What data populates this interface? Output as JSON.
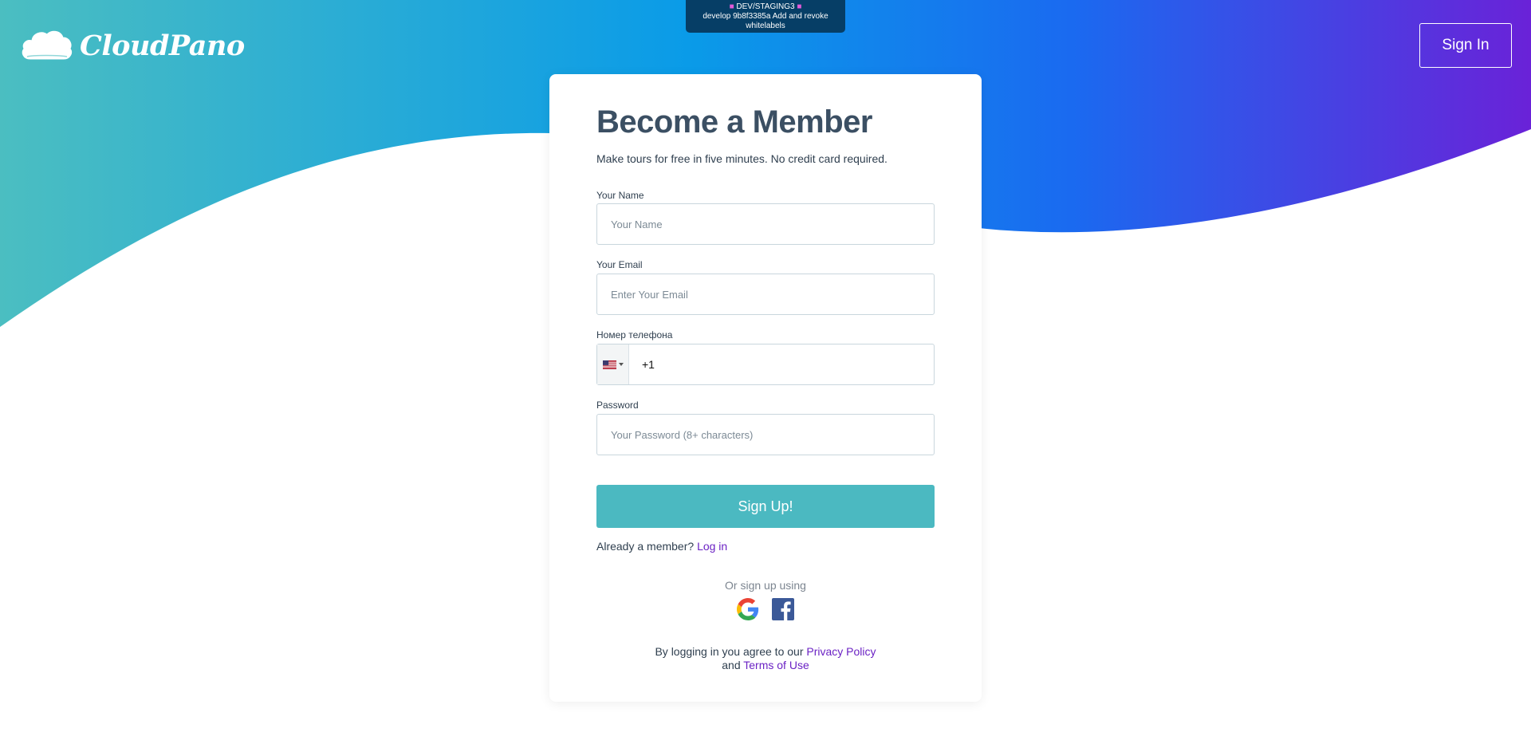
{
  "dev_banner": {
    "env": "DEV/STAGING3",
    "commit": "develop 9b8f3385a Add and revoke whitelabels"
  },
  "header": {
    "logo_text": "CloudPano",
    "signin_label": "Sign In"
  },
  "form": {
    "title": "Become a Member",
    "subtitle": "Make tours for free in five minutes. No credit card required.",
    "name": {
      "label": "Your Name",
      "placeholder": "Your Name"
    },
    "email": {
      "label": "Your Email",
      "placeholder": "Enter Your Email"
    },
    "phone": {
      "label": "Номер телефона",
      "country": "US",
      "value": "+1"
    },
    "password": {
      "label": "Password",
      "placeholder": "Your Password (8+ characters)"
    },
    "submit_label": "Sign Up!",
    "member_prompt": "Already a member?",
    "login_link": "Log in",
    "social_prompt": "Or sign up using",
    "social_icons": [
      "google-icon",
      "facebook-icon"
    ],
    "terms_prefix": "By logging in you agree to our",
    "privacy_link": "Privacy Policy",
    "terms_and": "and",
    "terms_link": "Terms of Use"
  },
  "colors": {
    "gradient_start": "#4bbec1",
    "gradient_mid": "#0a9be8",
    "gradient_end": "#6a22d8",
    "accent_button": "#4bb9c1",
    "link": "#6b22c4",
    "title": "#3b4f63",
    "banner": "#063e66"
  }
}
